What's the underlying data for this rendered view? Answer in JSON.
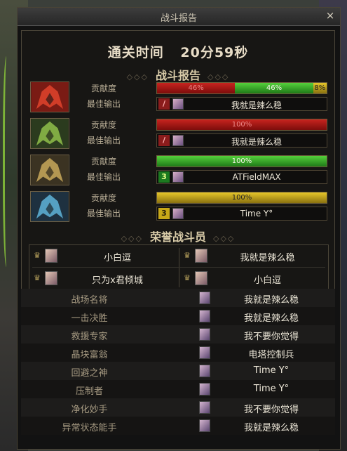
{
  "window": {
    "title": "战斗报告",
    "close": "×"
  },
  "clear_time": {
    "label": "通关时间",
    "value": "20分59秒"
  },
  "battle_report_title": "战斗报告",
  "labels": {
    "contribution": "贡献度",
    "best_output": "最佳输出"
  },
  "players": [
    {
      "frame": "red-dragon-icon",
      "contribution": [
        {
          "color": "red",
          "percent": 46,
          "text": "46%"
        },
        {
          "color": "green",
          "percent": 46,
          "text": "46%"
        },
        {
          "color": "yellow",
          "percent": 8,
          "text": "8%"
        }
      ],
      "best": {
        "badge": "/",
        "badge_color": "red",
        "name": "我就是辣么稳"
      }
    },
    {
      "frame": "green-dragon-icon",
      "contribution": [
        {
          "color": "red",
          "percent": 100,
          "text": "100%"
        }
      ],
      "best": {
        "badge": "/",
        "badge_color": "red",
        "name": "我就是辣么稳"
      }
    },
    {
      "frame": "gold-dragon-icon",
      "contribution": [
        {
          "color": "green",
          "percent": 100,
          "text": "100%"
        }
      ],
      "best": {
        "badge": "3",
        "badge_color": "green",
        "name": "ATFieldMAX"
      }
    },
    {
      "frame": "blue-dragon-icon",
      "contribution": [
        {
          "color": "yellow",
          "percent": 100,
          "text": "100%"
        }
      ],
      "best": {
        "badge": "3",
        "badge_color": "yellow",
        "name": "Time Y°"
      }
    }
  ],
  "honor_title": "荣誉战斗员",
  "honor": [
    "小白逗",
    "我就是辣么稳",
    "只为x君倾城",
    "小白逗"
  ],
  "awards": [
    {
      "title": "战场名将",
      "name": "我就是辣么稳"
    },
    {
      "title": "一击决胜",
      "name": "我就是辣么稳"
    },
    {
      "title": "救援专家",
      "name": "我不要你觉得"
    },
    {
      "title": "晶块富翁",
      "name": "电塔控制兵"
    },
    {
      "title": "回避之神",
      "name": "Time Y°"
    },
    {
      "title": "压制者",
      "name": "Time Y°"
    },
    {
      "title": "净化妙手",
      "name": "我不要你觉得"
    },
    {
      "title": "异常状态能手",
      "name": "我就是辣么稳"
    }
  ],
  "colors": {
    "red": "#c8241f",
    "green": "#3fb52e",
    "yellow": "#d9b826",
    "frame": "#6c5f45"
  }
}
